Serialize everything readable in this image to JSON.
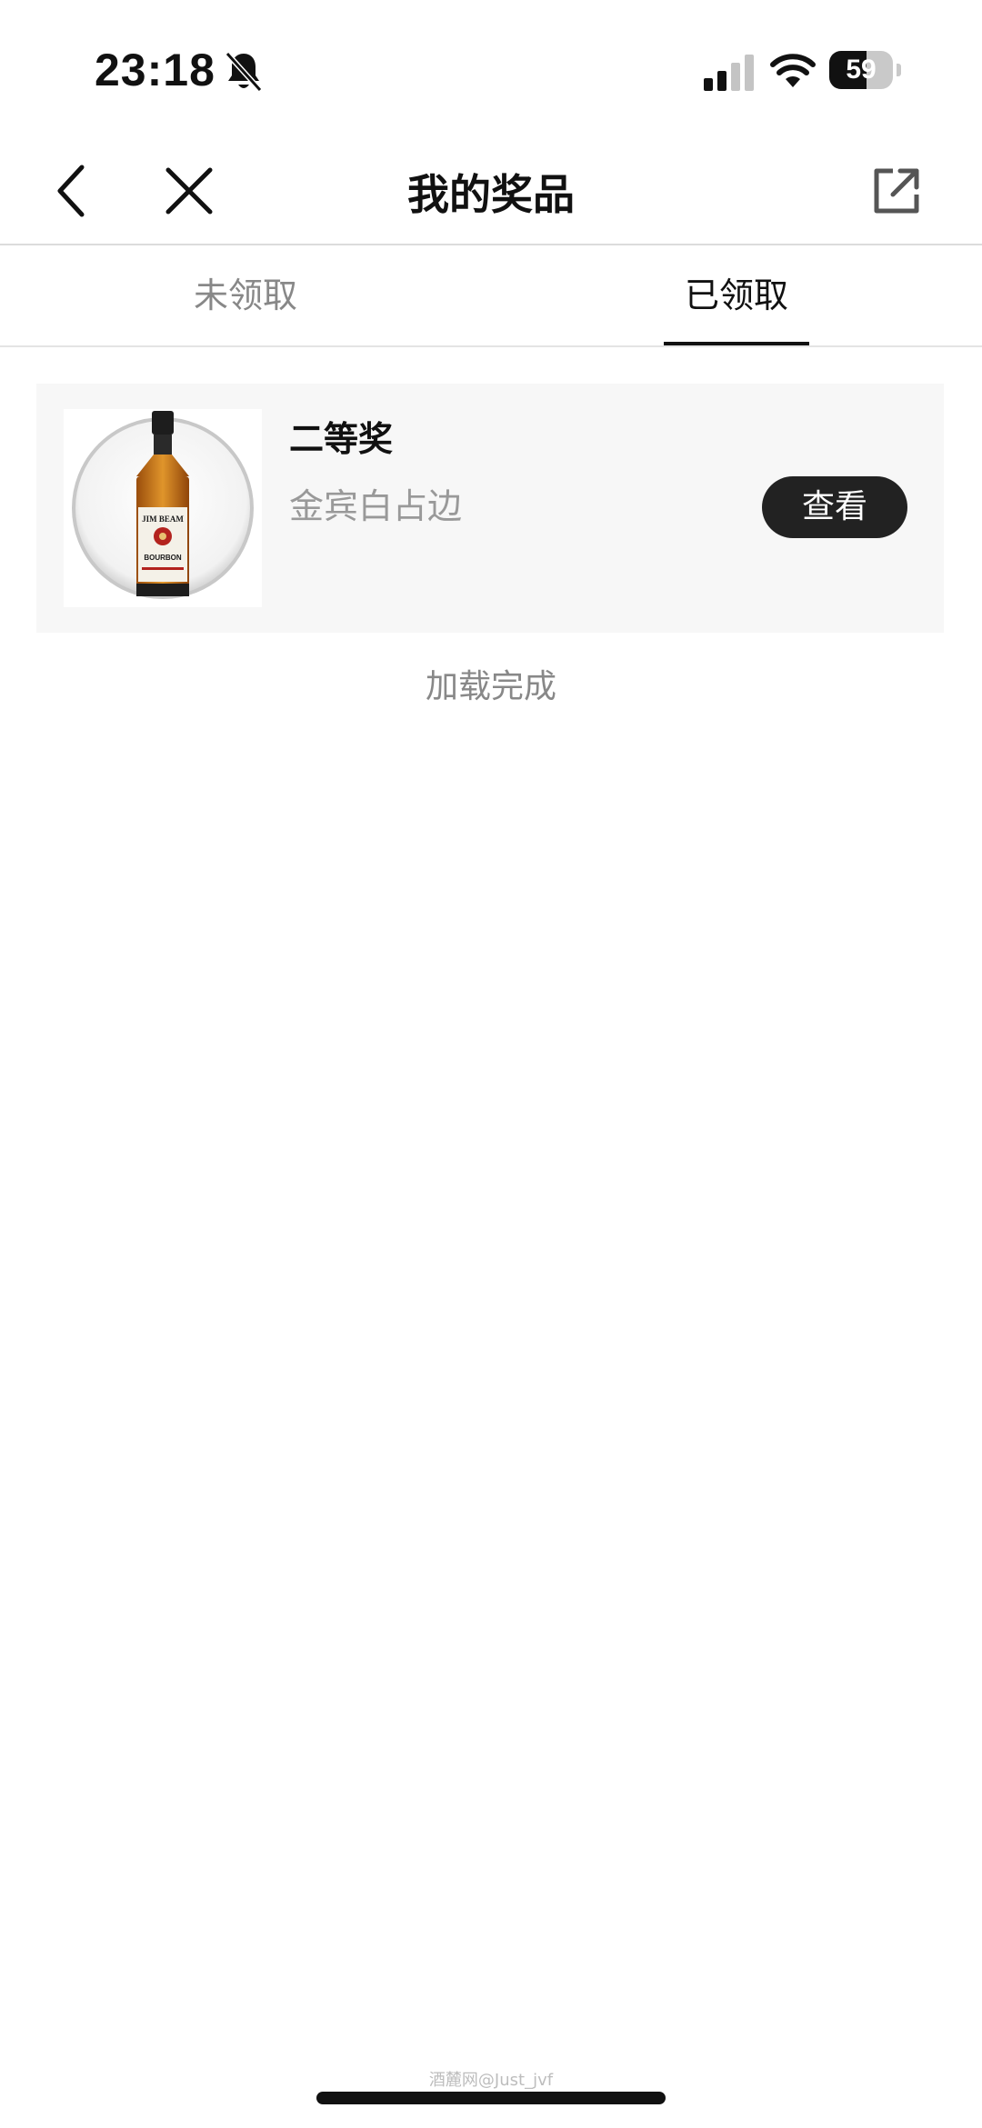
{
  "status_bar": {
    "time": "23:18",
    "battery": "59",
    "battery_level": 0.59
  },
  "nav": {
    "title": "我的奖品",
    "back_icon": "chevron-left-icon",
    "close_icon": "close-icon",
    "share_icon": "external-share-icon"
  },
  "tabs": [
    {
      "label": "未领取",
      "active": false
    },
    {
      "label": "已领取",
      "active": true
    }
  ],
  "prizes": [
    {
      "level": "二等奖",
      "name": "金宾白占边",
      "action_label": "查看",
      "image": "whiskey-bottle-image"
    }
  ],
  "list_status": "加载完成",
  "watermark": "酒麓网@Just_jvf",
  "colors": {
    "accent": "#222222",
    "muted_text": "#888888",
    "card_bg": "#f7f7f7"
  }
}
